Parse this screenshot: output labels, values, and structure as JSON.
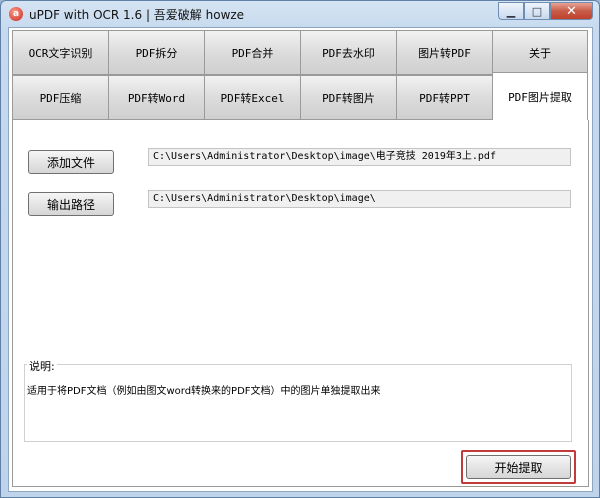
{
  "window": {
    "title": "uPDF with OCR 1.6 |  吾爱破解 howze",
    "app_icon_glyph": "a",
    "minimize_glyph": "▁",
    "maximize_glyph": "□",
    "close_glyph": "✕"
  },
  "tabs": {
    "row1": [
      "OCR文字识别",
      "PDF拆分",
      "PDF合并",
      "PDF去水印",
      "图片转PDF",
      "关于"
    ],
    "row2": [
      "PDF压缩",
      "PDF转Word",
      "PDF转Excel",
      "PDF转图片",
      "PDF转PPT",
      "PDF图片提取"
    ],
    "active": "PDF图片提取"
  },
  "panel": {
    "add_file_label": "添加文件",
    "input_path": "C:\\Users\\Administrator\\Desktop\\image\\电子竞技 2019年3上.pdf",
    "output_label": "输出路径",
    "output_path": "C:\\Users\\Administrator\\Desktop\\image\\",
    "description_label": "说明:",
    "description_text": "适用于将PDF文档（例如由图文word转换来的PDF文档）中的图片单独提取出来",
    "start_label": "开始提取"
  }
}
